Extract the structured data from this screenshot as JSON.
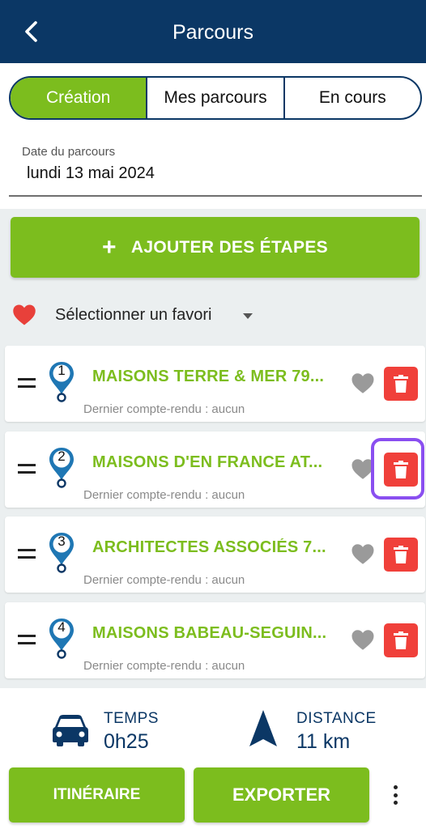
{
  "header": {
    "title": "Parcours",
    "back_icon": "chevron-left-icon"
  },
  "tabs": [
    {
      "label": "Création",
      "active": true
    },
    {
      "label": "Mes parcours",
      "active": false
    },
    {
      "label": "En cours",
      "active": false
    }
  ],
  "date_field": {
    "label": "Date du parcours",
    "value": "lundi 13 mai 2024"
  },
  "add_button": {
    "label": "AJOUTER DES ÉTAPES",
    "icon": "plus-icon"
  },
  "favorite": {
    "label": "Sélectionner un favori",
    "icon": "heart-icon"
  },
  "stops": [
    {
      "number": "1",
      "name": "MAISONS TERRE & MER 79...",
      "subtitle": "Dernier compte-rendu : aucun"
    },
    {
      "number": "2",
      "name": "MAISONS D'EN FRANCE AT...",
      "subtitle": "Dernier compte-rendu : aucun"
    },
    {
      "number": "3",
      "name": "ARCHITECTES ASSOCIÉS 7...",
      "subtitle": "Dernier compte-rendu : aucun"
    },
    {
      "number": "4",
      "name": "MAISONS BABEAU-SEGUIN...",
      "subtitle": "Dernier compte-rendu : aucun"
    }
  ],
  "stats": {
    "time": {
      "label": "TEMPS",
      "value": "0h25",
      "icon": "car-icon"
    },
    "distance": {
      "label": "DISTANCE",
      "value": "11 km",
      "icon": "navigation-arrow-icon"
    }
  },
  "actions": {
    "itinerary_label": "ITINÉRAIRE",
    "export_label": "EXPORTER",
    "more_icon": "more-vertical-icon"
  },
  "colors": {
    "header": "#0b3765",
    "accent_green": "#7cbd1e",
    "delete_red": "#f0403a",
    "highlight": "#8a4ff0",
    "pin_blue": "#1f77b4"
  }
}
